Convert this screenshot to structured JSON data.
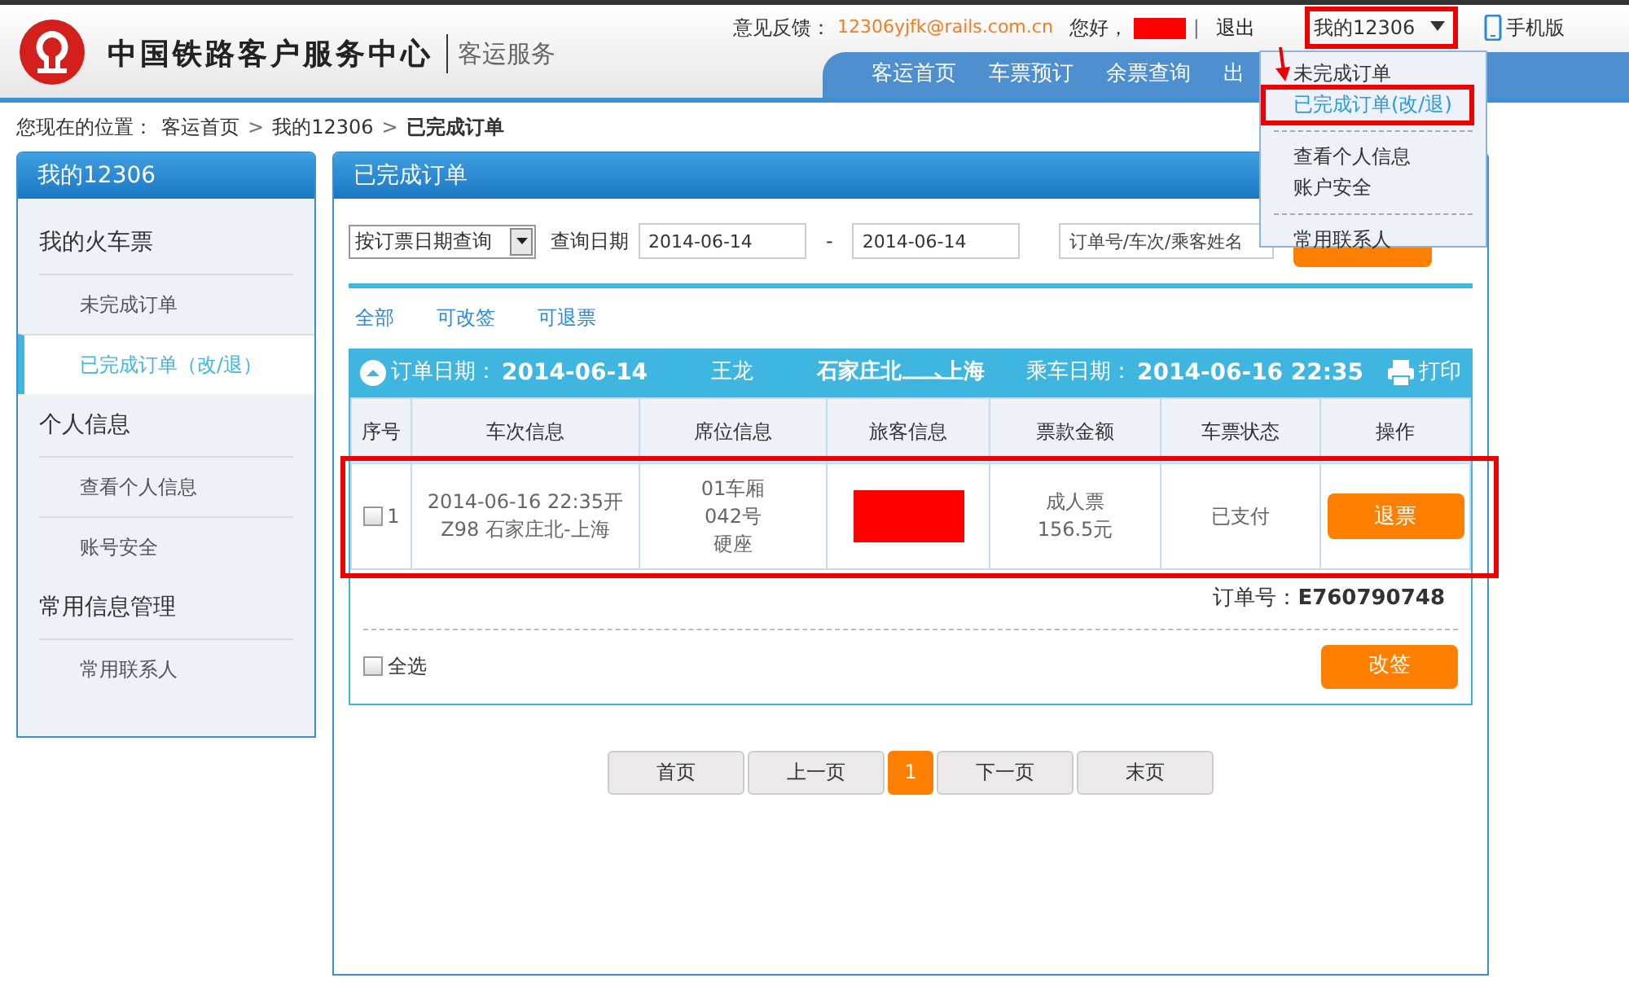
{
  "header": {
    "logo_title": "中国铁路客户服务中心",
    "logo_subtitle": "客运服务",
    "feedback_label": "意见反馈：",
    "feedback_email": "12306yjfk@rails.com.cn",
    "greeting": "您好，",
    "user_redacted": true,
    "separator": "|",
    "logout": "退出",
    "my_menu": {
      "label": "我的12306",
      "highlighted": true,
      "expanded": true
    },
    "mobile": "手机版"
  },
  "nav": [
    {
      "label": "客运首页"
    },
    {
      "label": "车票预订"
    },
    {
      "label": "余票查询"
    },
    {
      "label": "出"
    }
  ],
  "dropdown": {
    "groups": [
      [
        {
          "label": "未完成订单",
          "selected": false,
          "highlighted": false
        },
        {
          "label": "已完成订单(改/退)",
          "selected": true,
          "highlighted": true
        }
      ],
      [
        {
          "label": "查看个人信息",
          "selected": false,
          "highlighted": false
        },
        {
          "label": "账户安全",
          "selected": false,
          "highlighted": false
        }
      ],
      [
        {
          "label": "常用联系人",
          "selected": false,
          "highlighted": false
        }
      ]
    ]
  },
  "breadcrumb": [
    {
      "kind": "label",
      "text": "您现在的位置："
    },
    {
      "kind": "link",
      "text": "客运首页"
    },
    {
      "kind": "sep",
      "text": ">"
    },
    {
      "kind": "link",
      "text": "我的12306"
    },
    {
      "kind": "sep",
      "text": ">"
    },
    {
      "kind": "current",
      "text": "已完成订单"
    }
  ],
  "sidebar": {
    "title": "我的12306",
    "sections": [
      {
        "title": "我的火车票",
        "items": [
          {
            "label": "未完成订单",
            "selected": false
          },
          {
            "label": "已完成订单（改/退）",
            "selected": true
          }
        ]
      },
      {
        "title": "个人信息",
        "items": [
          {
            "label": "查看个人信息",
            "selected": false
          },
          {
            "label": "账号安全",
            "selected": false
          }
        ]
      },
      {
        "title": "常用信息管理",
        "items": [
          {
            "label": "常用联系人",
            "selected": false
          }
        ]
      }
    ]
  },
  "main": {
    "title": "已完成订单",
    "filter": {
      "query_type": "按订票日期查询",
      "date_label": "查询日期",
      "date_from": "2014-06-14",
      "dash": "-",
      "date_to": "2014-06-14",
      "search_placeholder": "订单号/车次/乘客姓名"
    },
    "tabs": [
      {
        "label": "全部"
      },
      {
        "label": "可改签"
      },
      {
        "label": "可退票"
      }
    ],
    "order": {
      "expanded": true,
      "order_date_label": "订单日期：",
      "order_date": "2014-06-14",
      "booker": "王龙",
      "from": "石家庄北",
      "to": "上海",
      "ride_label": "乘车日期：",
      "ride_date": "2014-06-16 22:35",
      "print": "打印",
      "columns": [
        "序号",
        "车次信息",
        "席位信息",
        "旅客信息",
        "票款金额",
        "车票状态",
        "操作"
      ],
      "rows": [
        {
          "no": "1",
          "checked": false,
          "train": [
            "2014-06-16 22:35开",
            "Z98 石家庄北-上海"
          ],
          "seat": [
            "01车厢",
            "042号",
            "硬座"
          ],
          "passenger_redacted": true,
          "fare": [
            "成人票",
            "156.5元"
          ],
          "status": "已支付",
          "action": "退票",
          "highlighted": true
        }
      ],
      "order_no_label": "订单号：",
      "order_no": "E760790748",
      "select_all": {
        "label": "全选",
        "checked": false
      },
      "change_button": "改签"
    },
    "pagination": [
      {
        "label": "首页",
        "selected": false
      },
      {
        "label": "上一页",
        "selected": false
      },
      {
        "label": "1",
        "selected": true
      },
      {
        "label": "下一页",
        "selected": false
      },
      {
        "label": "末页",
        "selected": false
      }
    ]
  }
}
